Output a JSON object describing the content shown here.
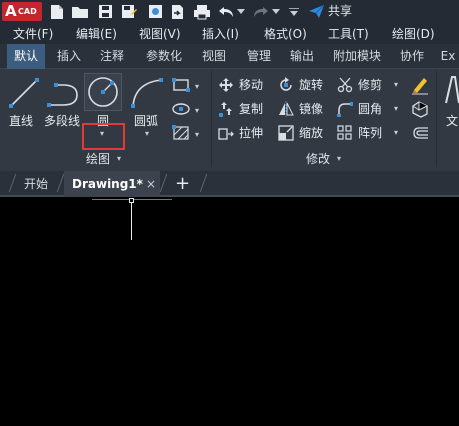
{
  "app": {
    "logo_big": "A",
    "logo_small": "CAD"
  },
  "quick_access": {
    "share_label": "共享"
  },
  "menu": [
    "文件(F)",
    "编辑(E)",
    "视图(V)",
    "插入(I)",
    "格式(O)",
    "工具(T)",
    "绘图(D)"
  ],
  "ribbon_tabs": [
    "默认",
    "插入",
    "注释",
    "参数化",
    "视图",
    "管理",
    "输出",
    "附加模块",
    "协作",
    "Ex"
  ],
  "draw_panel": {
    "line_label": "直线",
    "polyline_label": "多段线",
    "circle_label": "圆",
    "arc_label": "圆弧",
    "panel_title": "绘图",
    "dropdown_arrow": "▾"
  },
  "modify_panel": {
    "move_label": "移动",
    "rotate_label": "旋转",
    "trim_label": "修剪",
    "copy_label": "复制",
    "mirror_label": "镜像",
    "fillet_label": "圆角",
    "stretch_label": "拉伸",
    "scale_label": "缩放",
    "array_label": "阵列",
    "panel_title": "修改"
  },
  "annotation_panel": {
    "text_label": "文"
  },
  "doc_tabs": {
    "start_label": "开始",
    "drawing_label": "Drawing1*",
    "close_symbol": "×",
    "new_symbol": "+"
  },
  "colors": {
    "accent_tab": "#3d5d80",
    "logo_red": "#c3262d",
    "highlight_red": "#e03a3a",
    "ribbon_bg": "#323943",
    "canvas_bg": "#000000"
  }
}
